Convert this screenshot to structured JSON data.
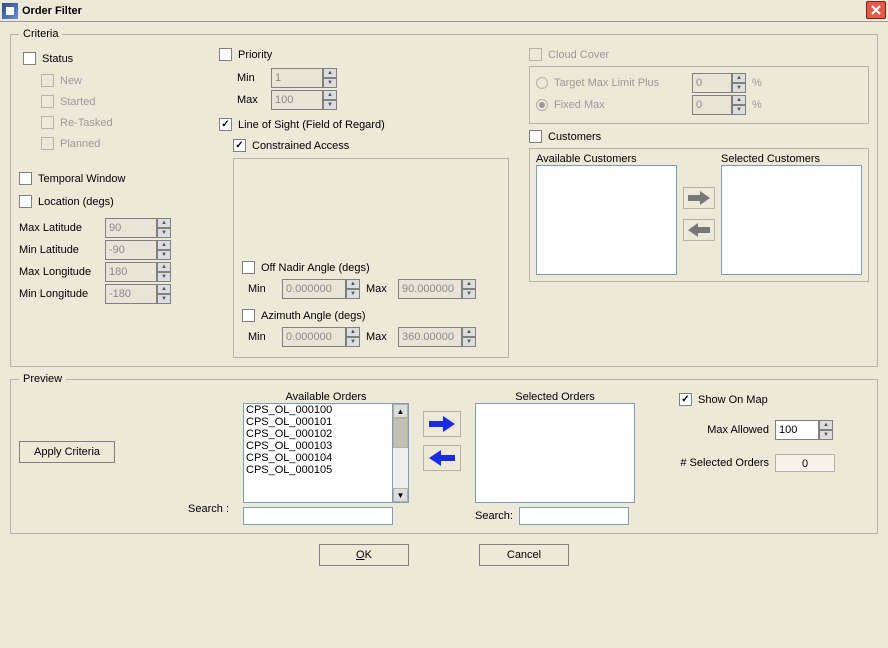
{
  "title": "Order Filter",
  "criteria": {
    "legend": "Criteria",
    "status": {
      "label": "Status",
      "items": {
        "new": "New",
        "started": "Started",
        "retasked": "Re-Tasked",
        "planned": "Planned"
      }
    },
    "temporal_label": "Temporal Window",
    "location": {
      "label": "Location (degs)",
      "maxlat_label": "Max Latitude",
      "maxlat_value": "90",
      "minlat_label": "Min Latitude",
      "minlat_value": "-90",
      "maxlon_label": "Max Longitude",
      "maxlon_value": "180",
      "minlon_label": "Min Longitude",
      "minlon_value": "-180"
    },
    "priority": {
      "label": "Priority",
      "min_label": "Min",
      "min_value": "1",
      "max_label": "Max",
      "max_value": "100"
    },
    "los_label": "Line of Sight (Field of Regard)",
    "constrained_label": "Constrained Access",
    "offnadir": {
      "label": "Off Nadir Angle (degs)",
      "min_label": "Min",
      "min_value": "0.000000",
      "max_label": "Max",
      "max_value": "90.000000"
    },
    "azimuth": {
      "label": "Azimuth Angle (degs)",
      "min_label": "Min",
      "min_value": "0.000000",
      "max_label": "Max",
      "max_value": "360.00000"
    },
    "cloud": {
      "label": "Cloud Cover",
      "tmlp_label": "Target Max Limit Plus",
      "tmlp_value": "0",
      "fixed_label": "Fixed Max",
      "fixed_value": "0",
      "pct": "%"
    },
    "customers": {
      "label": "Customers",
      "available_label": "Available Customers",
      "selected_label": "Selected Customers"
    }
  },
  "preview": {
    "legend": "Preview",
    "apply_label": "Apply Criteria",
    "available_title": "Available Orders",
    "selected_title": "Selected Orders",
    "search_label": "Search :",
    "search_label2": "Search:",
    "show_on_map_label": "Show On Map",
    "max_allowed_label": "Max Allowed",
    "max_allowed_value": "100",
    "selected_count_label": "# Selected Orders",
    "selected_count_value": "0",
    "orders": [
      "CPS_OL_000100",
      "CPS_OL_000101",
      "CPS_OL_000102",
      "CPS_OL_000103",
      "CPS_OL_000104",
      "CPS_OL_000105"
    ]
  },
  "buttons": {
    "ok": "OK",
    "cancel": "Cancel"
  }
}
